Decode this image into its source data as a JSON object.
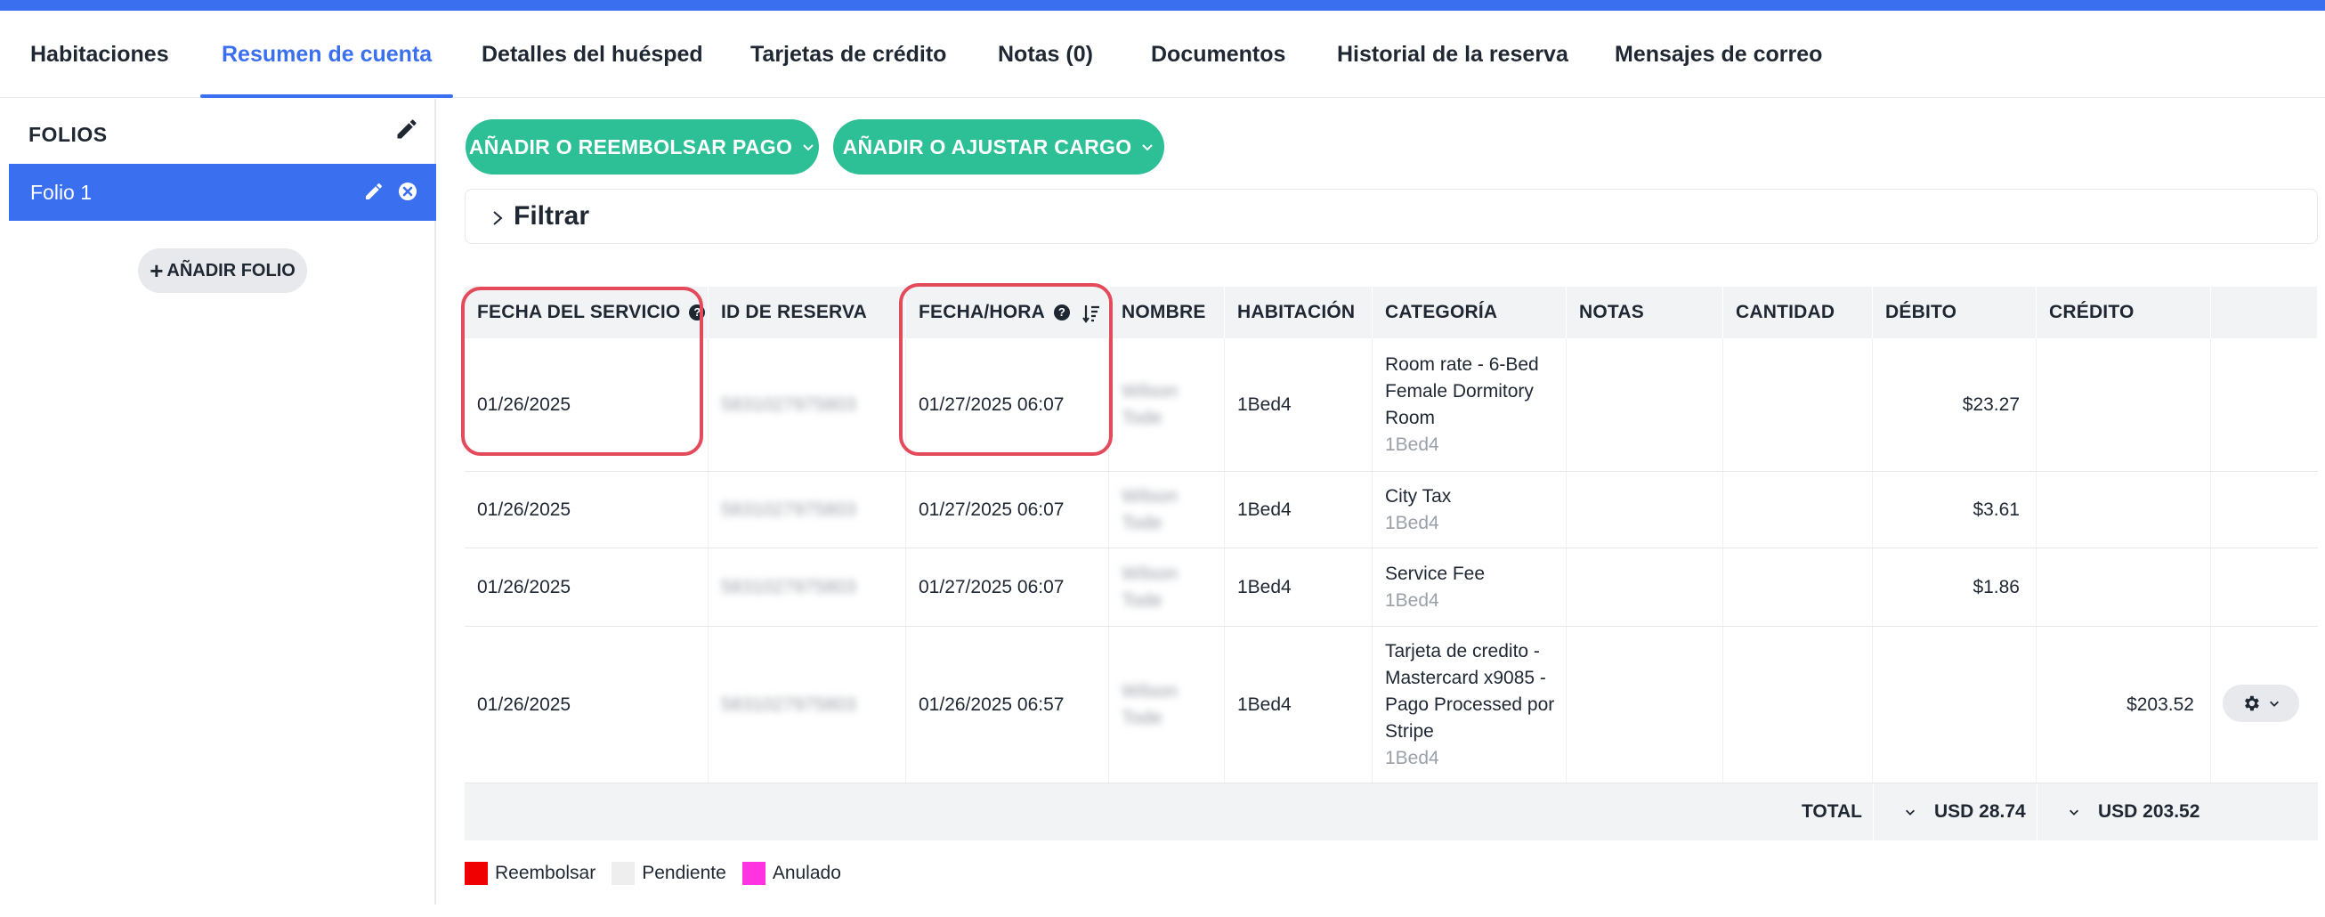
{
  "colors": {
    "accent": "#3a6ff0",
    "green": "#2dbf95",
    "highlight": "#e34a5a"
  },
  "tabs": [
    {
      "label": "Habitaciones",
      "active": false
    },
    {
      "label": "Resumen de cuenta",
      "active": true
    },
    {
      "label": "Detalles del huésped",
      "active": false
    },
    {
      "label": "Tarjetas de crédito",
      "active": false
    },
    {
      "label": "Notas (0)",
      "active": false
    },
    {
      "label": "Documentos",
      "active": false
    },
    {
      "label": "Historial de la reserva",
      "active": false
    },
    {
      "label": "Mensajes de correo",
      "active": false
    }
  ],
  "sidebar": {
    "title": "FOLIOS",
    "folio_label": "Folio 1",
    "add_folio_label": "AÑADIR FOLIO"
  },
  "actions": {
    "add_refund_payment": "AÑADIR O REEMBOLSAR PAGO",
    "add_adjust_charge": "AÑADIR O AJUSTAR CARGO"
  },
  "filter": {
    "label": "Filtrar"
  },
  "table": {
    "headers": {
      "service_date": "FECHA DEL SERVICIO",
      "reservation_id": "ID DE RESERVA",
      "datetime": "FECHA/HORA",
      "name": "NOMBRE",
      "room": "HABITACIÓN",
      "category": "CATEGORÍA",
      "notes": "NOTAS",
      "quantity": "CANTIDAD",
      "debit": "DÉBITO",
      "credit": "CRÉDITO"
    },
    "rows": [
      {
        "service_date": "01/26/2025",
        "reservation_id": "5831027975803",
        "datetime": "01/27/2025 06:07",
        "name_1": "Wilson",
        "name_2": "Tode",
        "room": "1Bed4",
        "category_lines": [
          "Room rate - 6-Bed",
          "Female Dormitory",
          "Room"
        ],
        "category_sub": "1Bed4",
        "notes": "",
        "quantity": "",
        "debit": "$23.27",
        "credit": ""
      },
      {
        "service_date": "01/26/2025",
        "reservation_id": "5831027975803",
        "datetime": "01/27/2025 06:07",
        "name_1": "Wilson",
        "name_2": "Tode",
        "room": "1Bed4",
        "category_lines": [
          "City Tax"
        ],
        "category_sub": "1Bed4",
        "notes": "",
        "quantity": "",
        "debit": "$3.61",
        "credit": ""
      },
      {
        "service_date": "01/26/2025",
        "reservation_id": "5831027975803",
        "datetime": "01/27/2025 06:07",
        "name_1": "Wilson",
        "name_2": "Tode",
        "room": "1Bed4",
        "category_lines": [
          "Service Fee"
        ],
        "category_sub": "1Bed4",
        "notes": "",
        "quantity": "",
        "debit": "$1.86",
        "credit": ""
      },
      {
        "service_date": "01/26/2025",
        "reservation_id": "5831027975803",
        "datetime": "01/26/2025 06:57",
        "name_1": "Wilson",
        "name_2": "Tode",
        "room": "1Bed4",
        "category_lines": [
          "Tarjeta de credito -",
          "Mastercard x9085 -",
          "Pago Processed por",
          "Stripe"
        ],
        "category_sub": "1Bed4",
        "notes": "",
        "quantity": "",
        "debit": "",
        "credit": "$203.52"
      }
    ],
    "totals": {
      "label": "TOTAL",
      "debit": "USD 28.74",
      "credit": "USD 203.52"
    }
  },
  "legend": [
    {
      "label": "Reembolsar",
      "color": "#f00000"
    },
    {
      "label": "Pendiente",
      "color": "#eeeeee"
    },
    {
      "label": "Anulado",
      "color": "#ff33e0"
    }
  ]
}
